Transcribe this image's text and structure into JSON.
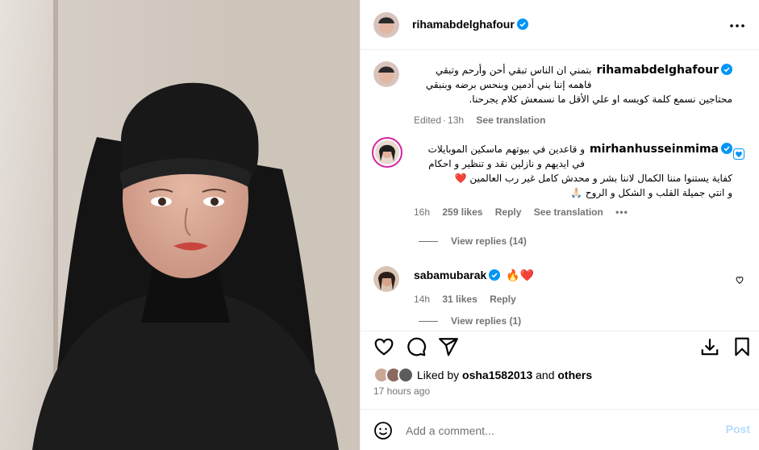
{
  "post": {
    "author": "rihamabdelghafour",
    "more_icon": "more-horizontal-icon"
  },
  "caption": {
    "username": "rihamabdelghafour",
    "text": "بتمني ان الناس تبقي أحن وأرحم وتبقي فاهمه إننا بني أدمين وبنحس برضه وبنبقي محتاجين نسمع كلمة كويسه او علي الأقل ما نسمعش كلام يجرحنا.",
    "edited_label": "Edited",
    "time": "13h",
    "see_translation": "See translation"
  },
  "comments": [
    {
      "username": "mirhanhusseinmima",
      "text_line1": "و قاعدين في بيوتهم ماسكين الموبايلات في ايديهم و نازلين نقد و تنظير و احكام كفاية يستنوا مننا الكمال لاننا بشر و محدش كامل غير رب العالمين ❤️",
      "text_line2": "و انتي جميلة القلب و الشكل و الروح 🙏🏻",
      "time": "16h",
      "likes": "259 likes",
      "reply": "Reply",
      "see_translation": "See translation",
      "view_replies": "View replies (14)"
    },
    {
      "username": "sabamubarak",
      "text": "🔥❤️",
      "time": "14h",
      "likes": "31 likes",
      "reply": "Reply",
      "view_replies": "View replies (1)"
    }
  ],
  "likes_summary": {
    "prefix": "Liked by",
    "user": "osha1582013",
    "and": "and",
    "others": "others"
  },
  "timestamp": "17 hours ago",
  "add_comment": {
    "placeholder": "Add a comment...",
    "post_label": "Post"
  },
  "colors": {
    "verified": "#0095f6",
    "muted": "#737373",
    "post_disabled": "#b3dbff",
    "border": "#efefef"
  }
}
